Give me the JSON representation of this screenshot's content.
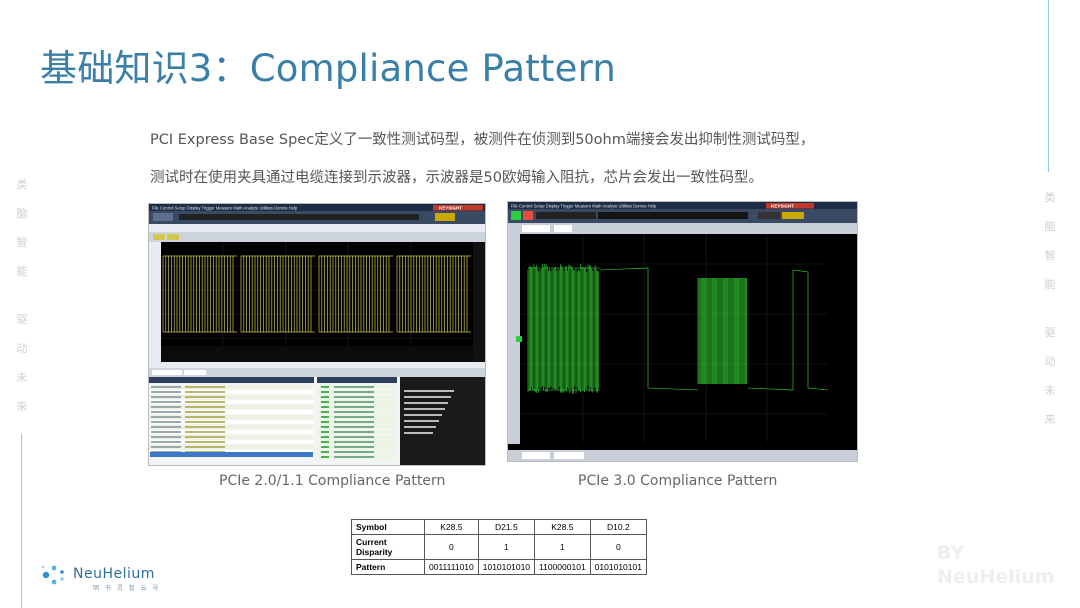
{
  "title": "基础知识3：Compliance Pattern",
  "intro": {
    "line1": "PCI Express Base Spec定义了一致性测试码型，被测件在侦测到50ohm端接会发出抑制性测试码型，",
    "line2": "测试时在使用夹具通过电缆连接到示波器，示波器是50欧姆输入阻抗，芯片会发出一致性码型。"
  },
  "side_left": [
    "类",
    "脑",
    "智",
    "能",
    "驱",
    "动",
    "未",
    "来"
  ],
  "side_right": [
    "类",
    "脑",
    "智",
    "能",
    "驱",
    "动",
    "未",
    "来"
  ],
  "screenshots": [
    {
      "caption": "PCIe 2.0/1.1 Compliance Pattern",
      "brand": "KEYSIGHT",
      "menu": "File Control Setup Display Trigger Measure Math Analyze Utilities Demos Help",
      "colors": {
        "trace": "#c8c84a",
        "bg": "#000000"
      }
    },
    {
      "caption": "PCIe 3.0 Compliance Pattern",
      "brand": "KEYSIGHT",
      "menu": "File Control Setup Display Trigger Measure Math Analyze Utilities Demos Help",
      "colors": {
        "trace": "#37e83a",
        "bg": "#000000"
      }
    }
  ],
  "symbol_table": {
    "rows": [
      {
        "label": "Symbol",
        "cells": [
          "K28.5",
          "D21.5",
          "K28.5",
          "D10.2"
        ]
      },
      {
        "label": "Current Disparity",
        "cells": [
          "0",
          "1",
          "1",
          "0"
        ]
      },
      {
        "label": "Pattern",
        "cells": [
          "0011111010",
          "1010101010",
          "1100000101",
          "0101010101"
        ]
      }
    ]
  },
  "logo": {
    "name": "NeuHelium",
    "sub": "明 书 灵 智 云 号"
  },
  "watermark": {
    "line1": "BY",
    "line2": "NeuHelium"
  },
  "colors": {
    "accent": "#3a7fa8",
    "line": "#8fcbe8"
  }
}
